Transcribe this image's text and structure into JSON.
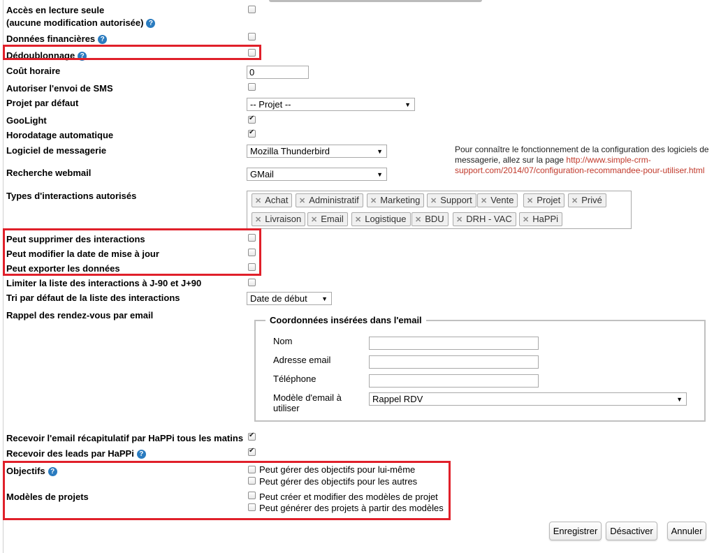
{
  "fields": {
    "readonly": "Accès en lecture seule",
    "readonly_sub": "(aucune modification autorisée)",
    "financial": "Données financières",
    "dedup": "Dédoublonnage",
    "hourly_cost": "Coût horaire",
    "hourly_cost_value": "0",
    "sms": "Autoriser l'envoi de SMS",
    "default_project": "Projet par défaut",
    "default_project_value": "-- Projet --",
    "goolight": "GooLight",
    "auto_timestamp": "Horodatage automatique",
    "mail_software": "Logiciel de messagerie",
    "mail_software_value": "Mozilla Thunderbird",
    "webmail": "Recherche webmail",
    "webmail_value": "GMail",
    "interaction_types": "Types d'interactions autorisés",
    "can_delete": "Peut supprimer des interactions",
    "can_modify_date": "Peut modifier la date de mise à jour",
    "can_export": "Peut exporter les données",
    "limit_list": "Limiter la liste des interactions à J-90 et J+90",
    "default_sort": "Tri par défaut de la liste des interactions",
    "default_sort_value": "Date de début",
    "reminder": "Rappel des rendez-vous par email",
    "recap_email": "Recevoir l'email récapitulatif par HaPPi tous les matins",
    "leads": "Recevoir des leads par HaPPi",
    "objectives": "Objectifs",
    "project_templates": "Modèles de projets"
  },
  "info": {
    "text": "Pour connaître le fonctionnement de la configuration des logiciels de messagerie, allez sur la page ",
    "link": "http://www.simple-crm-support.com/2014/07/configuration-recommandee-pour-utiliser.html"
  },
  "tags": [
    "Achat",
    "Administratif",
    "Marketing",
    "Support",
    "Vente",
    "Projet",
    "Privé",
    "Livraison",
    "Email",
    "Logistique",
    "BDU",
    "DRH - VAC",
    "HaPPi"
  ],
  "email_fieldset": {
    "legend": "Coordonnées insérées dans l'email",
    "name": "Nom",
    "email": "Adresse email",
    "phone": "Téléphone",
    "template": "Modèle d'email à utiliser",
    "template_value": "Rappel RDV"
  },
  "options": {
    "obj_self": "Peut gérer des objectifs pour lui-même",
    "obj_others": "Peut gérer des objectifs pour les autres",
    "tpl_create": "Peut créer et modifier des modèles de projet",
    "tpl_generate": "Peut générer des projets à partir des modèles"
  },
  "buttons": {
    "save": "Enregistrer",
    "deactivate": "Désactiver",
    "cancel": "Annuler"
  },
  "help_icon": "?",
  "highlight_color": "#e0202a"
}
